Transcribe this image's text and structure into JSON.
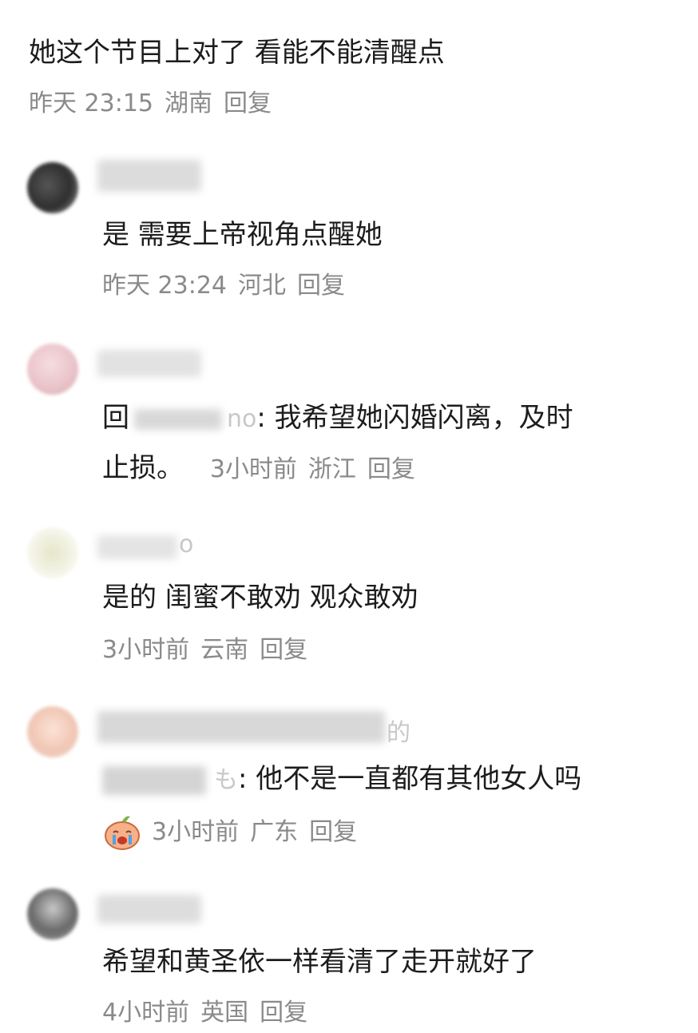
{
  "top_comment": {
    "text": "她这个节目上对了 看能不能清醒点",
    "time": "昨天 23:15",
    "location": "湖南",
    "reply": "回复"
  },
  "replies": [
    {
      "text": "是 需要上帝视角点醒她",
      "time": "昨天 23:24",
      "location": "河北",
      "reply": "回复"
    },
    {
      "prefix": "回",
      "name_tail": "no",
      "text_line1": ": 我希望她闪婚闪离，及时",
      "text_line2": "止损。",
      "time": "3小时前",
      "location": "浙江",
      "reply": "回复"
    },
    {
      "name_tail": "o",
      "text": "是的 闺蜜不敢劝 观众敢劝",
      "time": "3小时前",
      "location": "云南",
      "reply": "回复"
    },
    {
      "name_tail": "的",
      "mention_tail": "も",
      "text": ": 他不是一直都有其他女人吗",
      "time": "3小时前",
      "location": "广东",
      "reply": "回复"
    },
    {
      "text": "希望和黄圣依一样看清了走开就好了",
      "time": "4小时前",
      "location": "英国",
      "reply": "回复"
    }
  ]
}
